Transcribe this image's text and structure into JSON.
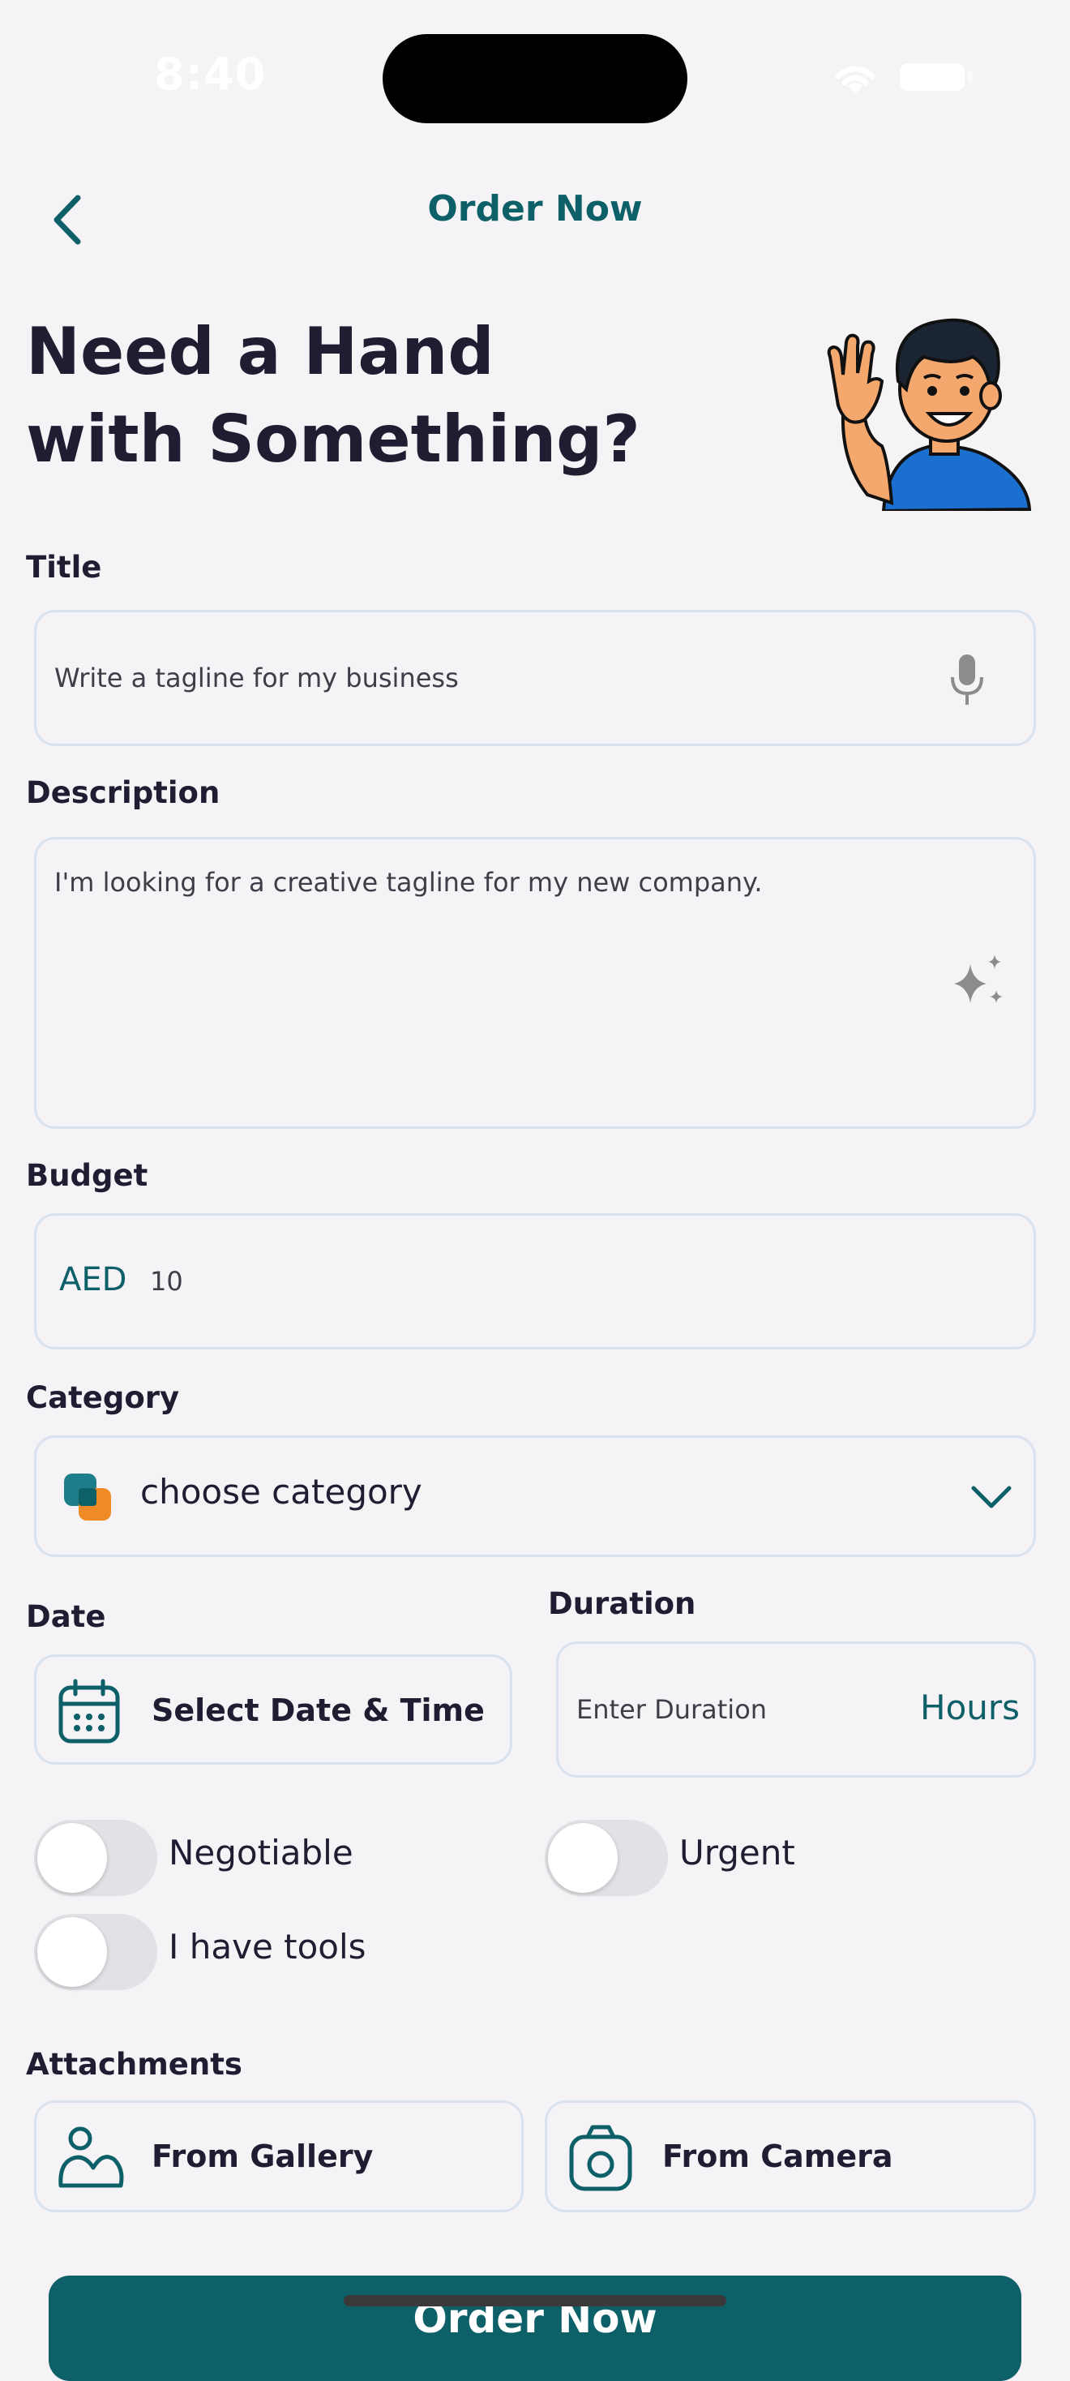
{
  "status_bar": {
    "time": "8:40"
  },
  "header": {
    "title": "Order Now"
  },
  "hero": {
    "line1": "Need a Hand",
    "line2": "with Something?"
  },
  "form": {
    "title": {
      "label": "Title",
      "placeholder": "Write a tagline for my business"
    },
    "description": {
      "label": "Description",
      "placeholder": "I'm looking for a creative tagline for my new company."
    },
    "budget": {
      "label": "Budget",
      "currency": "AED",
      "value": "10"
    },
    "category": {
      "label": "Category",
      "placeholder": "choose category"
    },
    "date": {
      "label": "Date",
      "button": "Select Date & Time"
    },
    "duration": {
      "label": "Duration",
      "placeholder": "Enter Duration",
      "unit": "Hours"
    },
    "toggles": [
      {
        "label": "Negotiable",
        "on": false
      },
      {
        "label": "Urgent",
        "on": false
      },
      {
        "label": "I have tools",
        "on": false
      }
    ],
    "attachments": {
      "label": "Attachments",
      "gallery": "From Gallery",
      "camera": "From Camera"
    }
  },
  "submit": {
    "label": "Order Now"
  },
  "colors": {
    "accent": "#0d5f68",
    "background": "#f5f3f5",
    "field_border": "#d9e2ee",
    "text": "#201d33",
    "category_orange": "#f08a24",
    "category_teal": "#1e7f8a",
    "mascot_shirt": "#1a6fcf"
  },
  "icons": [
    "back-chevron-icon",
    "microphone-icon",
    "sparkles-icon",
    "category-icon",
    "chevron-down-icon",
    "calendar-icon",
    "gallery-icon",
    "camera-icon"
  ]
}
